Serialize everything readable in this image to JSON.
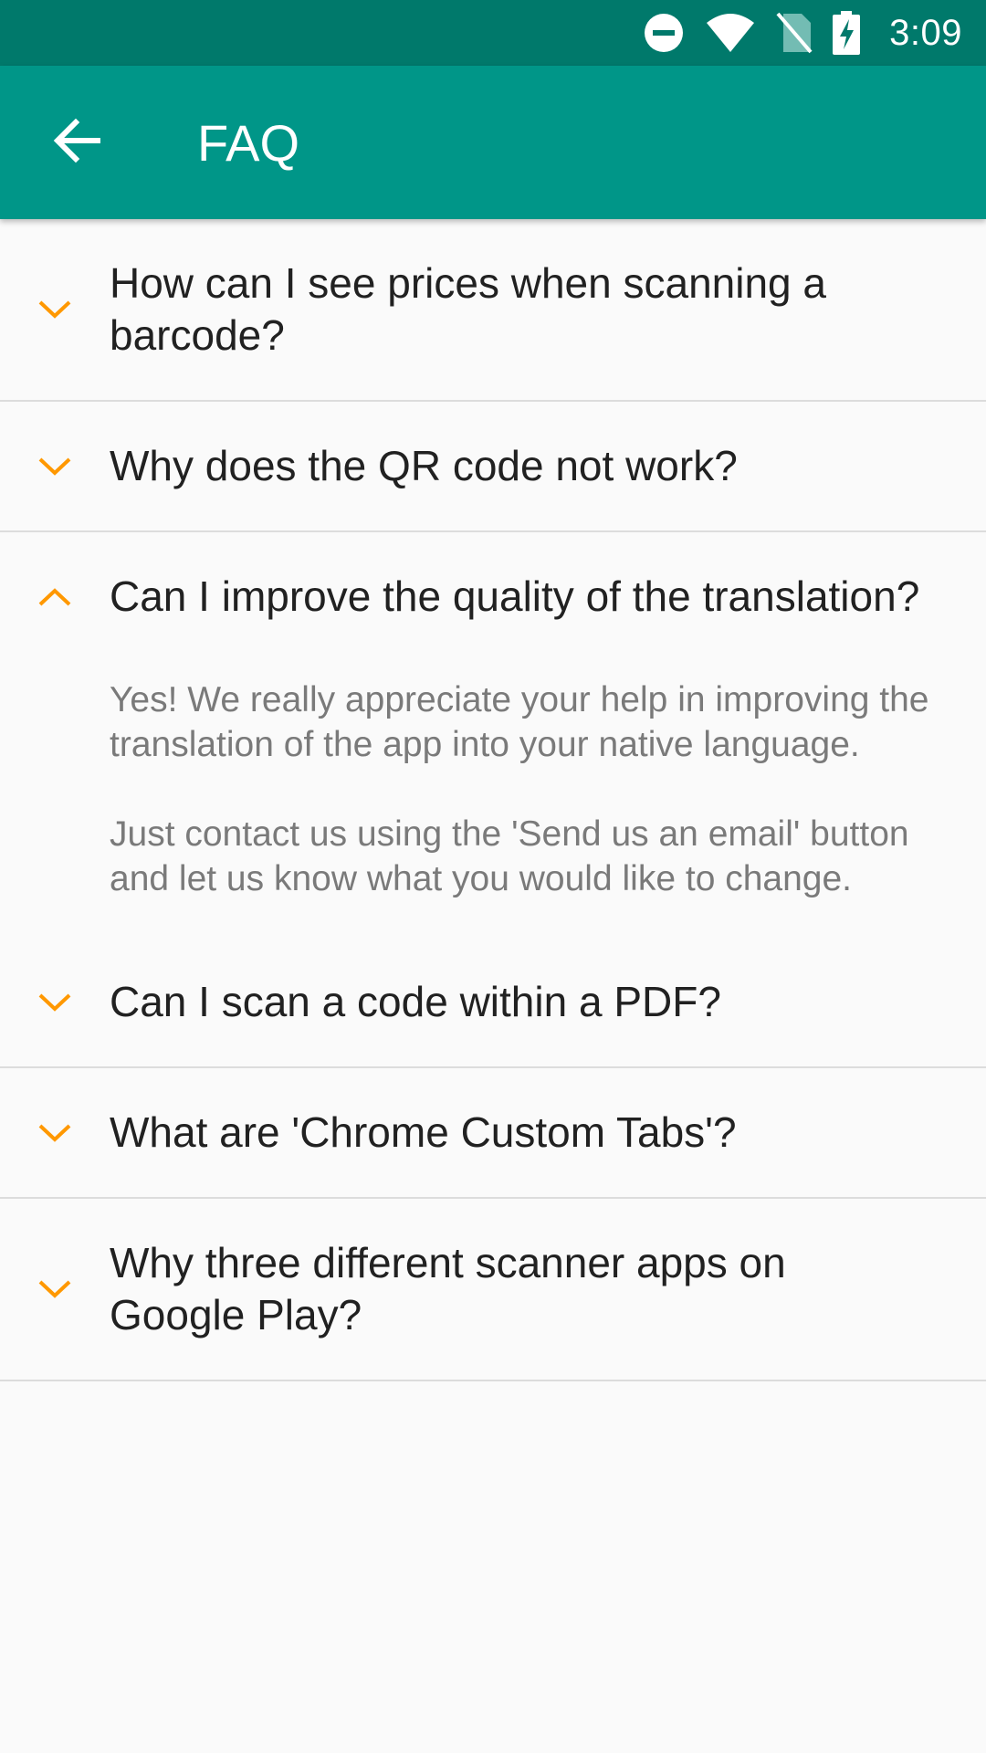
{
  "status_bar": {
    "time": "3:09",
    "icons": [
      "do-not-disturb-icon",
      "wifi-icon",
      "no-sim-icon",
      "battery-charging-icon"
    ]
  },
  "app_bar": {
    "title": "FAQ",
    "back_icon": "arrow-back-icon"
  },
  "colors": {
    "status_bar": "#00796b",
    "app_bar": "#009688",
    "accent": "#ff9800",
    "background": "#fafafa"
  },
  "faq": {
    "items": [
      {
        "question": "How can I see prices when scanning a barcode?",
        "expanded": false
      },
      {
        "question": "Why does the QR code not work?",
        "expanded": false
      },
      {
        "question": "Can I improve the quality of the translation?",
        "expanded": true,
        "answer": [
          "Yes! We really appreciate your help in improving the translation of the app into your native language.",
          "Just contact us using the 'Send us an email' button and let us know what you would like to change."
        ]
      },
      {
        "question": "Can I scan a code within a PDF?",
        "expanded": false
      },
      {
        "question": "What are 'Chrome Custom Tabs'?",
        "expanded": false
      },
      {
        "question": "Why three different scanner apps on Google Play?",
        "expanded": false
      }
    ]
  }
}
